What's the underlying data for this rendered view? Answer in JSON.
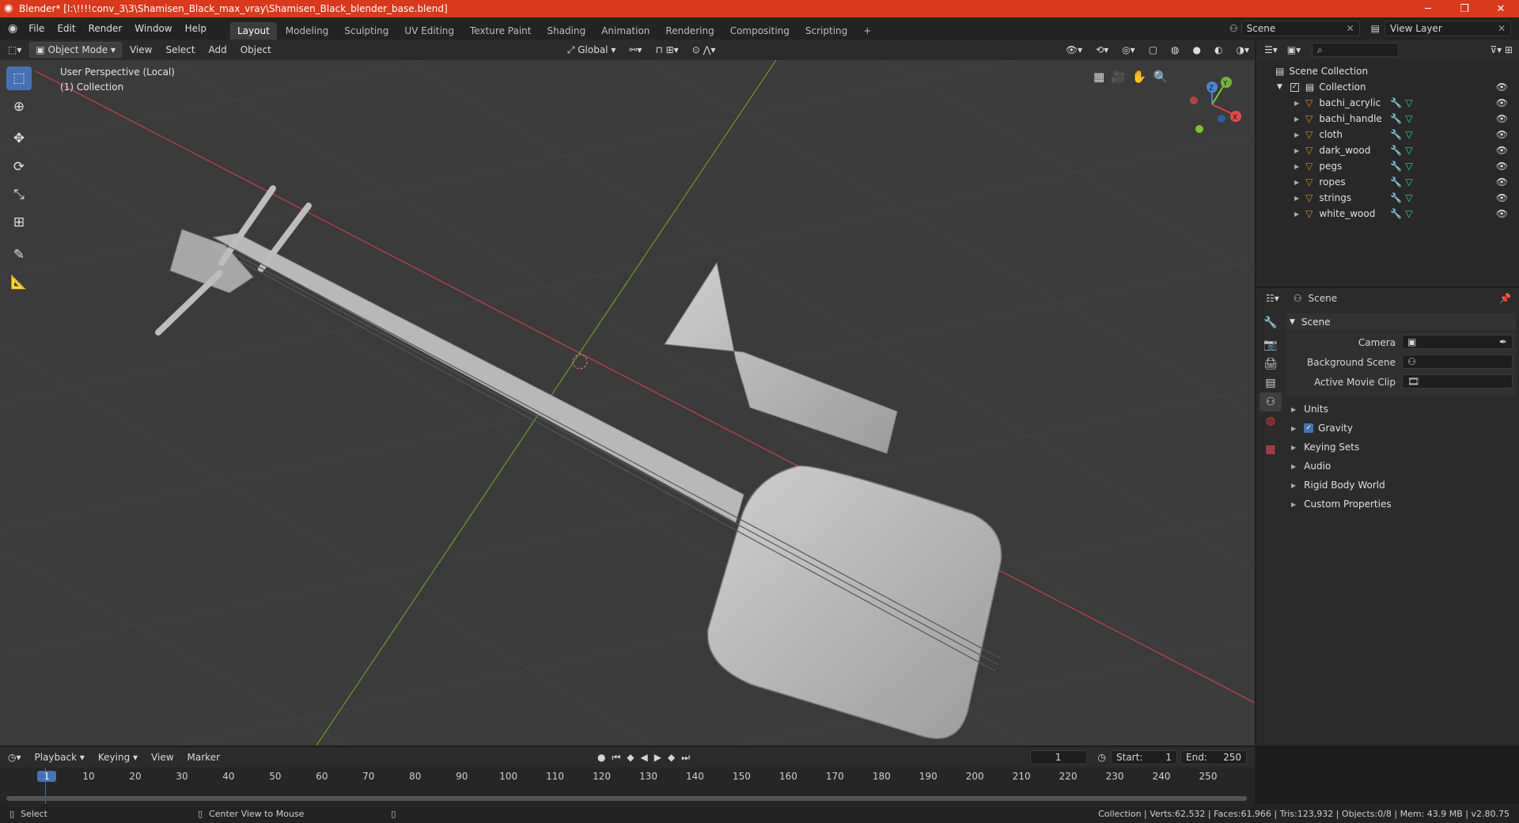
{
  "window": {
    "title": "Blender* [I:\\!!!!conv_3\\3\\Shamisen_Black_max_vray\\Shamisen_Black_blender_base.blend]",
    "minimize": "─",
    "maximize": "❐",
    "close": "✕"
  },
  "menu": [
    "File",
    "Edit",
    "Render",
    "Window",
    "Help"
  ],
  "workspaces": [
    "Layout",
    "Modeling",
    "Sculpting",
    "UV Editing",
    "Texture Paint",
    "Shading",
    "Animation",
    "Rendering",
    "Compositing",
    "Scripting",
    "+"
  ],
  "topright": {
    "scene_label": "Scene",
    "view_layer_label": "View Layer"
  },
  "viewport": {
    "mode": "Object Mode",
    "menus": [
      "View",
      "Select",
      "Add",
      "Object"
    ],
    "transform": "Global",
    "overlay_line1": "User Perspective (Local)",
    "overlay_line2": "(1) Collection",
    "gizmo": {
      "z": "Z",
      "y": "Y",
      "x": "X"
    }
  },
  "outliner": {
    "root": "Scene Collection",
    "collection": "Collection",
    "objects": [
      "bachi_acrylic",
      "bachi_handle",
      "cloth",
      "dark_wood",
      "pegs",
      "ropes",
      "strings",
      "white_wood"
    ]
  },
  "properties": {
    "header": "Scene",
    "section": "Scene",
    "fields": [
      {
        "label": "Camera"
      },
      {
        "label": "Background Scene"
      },
      {
        "label": "Active Movie Clip"
      }
    ],
    "subsections": [
      "Units",
      "Gravity",
      "Keying Sets",
      "Audio",
      "Rigid Body World",
      "Custom Properties"
    ]
  },
  "timeline": {
    "menus": [
      "Playback",
      "Keying",
      "View",
      "Marker"
    ],
    "current_frame": "1",
    "start_label": "Start:",
    "start": "1",
    "end_label": "End:",
    "end": "250",
    "ticks": [
      "1",
      "10",
      "20",
      "30",
      "40",
      "50",
      "60",
      "70",
      "80",
      "90",
      "100",
      "110",
      "120",
      "130",
      "140",
      "150",
      "160",
      "170",
      "180",
      "190",
      "200",
      "210",
      "220",
      "230",
      "240",
      "250"
    ]
  },
  "status": {
    "left": "Select",
    "middle": "Center View to Mouse",
    "right": "Collection | Verts:62,532 | Faces:61,966 | Tris:123,932 | Objects:0/8 | Mem: 43.9 MB | v2.80.75"
  },
  "colors": {
    "title_bar": "#d9391d",
    "accent": "#4672b4",
    "object_icon": "#e38b2f",
    "modifier_icon": "#6aa7e8",
    "mesh_icon": "#35d5a7"
  }
}
